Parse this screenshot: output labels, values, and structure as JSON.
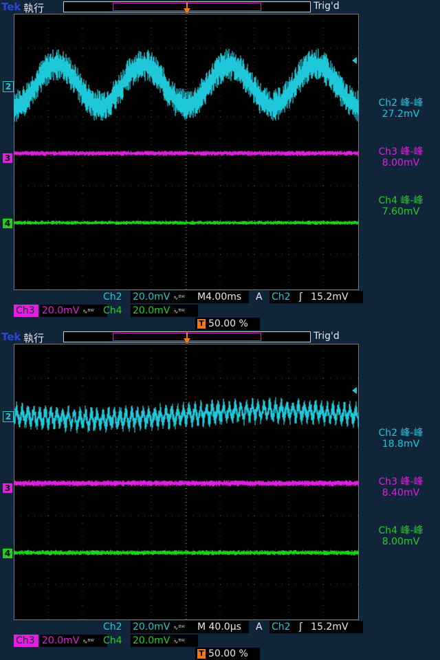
{
  "screens": [
    {
      "brand": "Tek",
      "mode": "執行",
      "trig_status": "Trig'd",
      "trig_marker": "T",
      "channels": [
        {
          "id": "2",
          "color": "#1ec8d8",
          "label": "Ch2",
          "meas_name": "Ch2 峰-峰",
          "meas_value": "27.2mV"
        },
        {
          "id": "3",
          "color": "#e020e0",
          "label": "Ch3",
          "meas_name": "Ch3 峰-峰",
          "meas_value": "8.00mV"
        },
        {
          "id": "4",
          "color": "#20d020",
          "label": "Ch4",
          "meas_name": "Ch4 峰-峰",
          "meas_value": "7.60mV"
        }
      ],
      "status": {
        "ch2_label": "Ch2",
        "ch2_scale": "20.0mV",
        "bw_icon": "∿ᴮᵂ",
        "timebase": "M4.00ms",
        "acq": "A",
        "trig_source": "Ch2",
        "trig_slope_icon": "ʃ",
        "trig_level": "15.2mV",
        "ch3_label": "Ch3",
        "ch3_scale": "20.0mV",
        "ch4_label": "Ch4",
        "ch4_scale": "20.0mV",
        "trig_pos_icon": "T",
        "trig_pos": "50.00 %"
      },
      "waveform": {
        "ch2_periods": 4,
        "ch2_amplitude_div": 0.6,
        "ch2_noise_div": 0.4,
        "ch3_noise_div": 0.1,
        "ch4_noise_div": 0.08
      }
    },
    {
      "brand": "Tek",
      "mode": "執行",
      "trig_status": "Trig'd",
      "trig_marker": "T",
      "channels": [
        {
          "id": "2",
          "color": "#1ec8d8",
          "label": "Ch2",
          "meas_name": "Ch2 峰-峰",
          "meas_value": "18.8mV"
        },
        {
          "id": "3",
          "color": "#e020e0",
          "label": "Ch3",
          "meas_name": "Ch3 峰-峰",
          "meas_value": "8.40mV"
        },
        {
          "id": "4",
          "color": "#20d020",
          "label": "Ch4",
          "meas_name": "Ch4 峰-峰",
          "meas_value": "8.00mV"
        }
      ],
      "status": {
        "ch2_label": "Ch2",
        "ch2_scale": "20.0mV",
        "bw_icon": "∿ᴮᵂ",
        "timebase": "M 40.0µs",
        "acq": "A",
        "trig_source": "Ch2",
        "trig_slope_icon": "ʃ",
        "trig_level": "15.2mV",
        "ch3_label": "Ch3",
        "ch3_scale": "20.0mV",
        "ch4_label": "Ch4",
        "ch4_scale": "20.0mV",
        "trig_pos_icon": "T",
        "trig_pos": "50.00 %"
      },
      "waveform": {
        "ch2_periods": 60,
        "ch2_amplitude_div": 0.35,
        "ch2_noise_div": 0.2,
        "ch3_noise_div": 0.12,
        "ch4_noise_div": 0.1
      }
    }
  ]
}
